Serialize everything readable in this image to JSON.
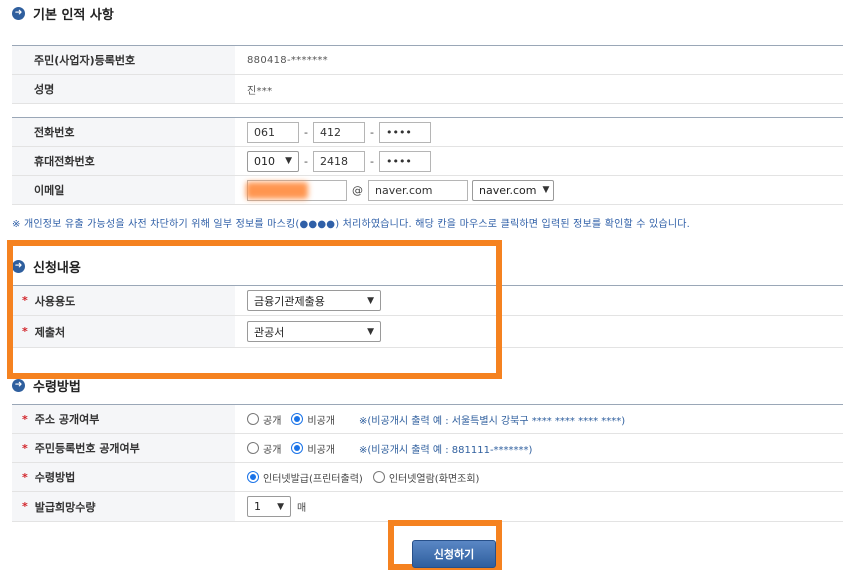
{
  "basic": {
    "title": "기본 인적 사항",
    "rrn_label": "주민(사업자)등록번호",
    "rrn_value": "880418-*******",
    "name_label": "성명",
    "name_value": "진***"
  },
  "contact": {
    "phone_label": "전화번호",
    "phone": [
      "061",
      "412",
      "••••"
    ],
    "mobile_label": "휴대전화번호",
    "mobile_prefix": "010",
    "mobile": [
      "2418",
      "••••"
    ],
    "email_label": "이메일",
    "email_at": "@",
    "email_domain": "naver.com",
    "email_domain_select": "naver.com",
    "dash": "-"
  },
  "notice": "※ 개인정보 유출 가능성을 사전 차단하기 위해 일부 정보를 마스킹(●●●●) 처리하였습니다. 해당 칸을 마우스로 클릭하면 입력된 정보를 확인할 수 있습니다.",
  "application": {
    "title": "신청내용",
    "purpose_label": "사용용도",
    "purpose_value": "금융기관제출용",
    "submit_to_label": "제출처",
    "submit_to_value": "관공서"
  },
  "receipt": {
    "title": "수령방법",
    "addr_label": "주소 공개여부",
    "addr_public": "공개",
    "addr_private": "비공개",
    "addr_note": "※(비공개시 출력 예 : 서울특별시 강북구 **** **** **** ****)",
    "rrn_label": "주민등록번호 공개여부",
    "rrn_public": "공개",
    "rrn_private": "비공개",
    "rrn_note": "※(비공개시 출력 예 : 881111-*******)",
    "method_label": "수령방법",
    "method_online_print": "인터넷발급(프린터출력)",
    "method_online_view": "인터넷열람(화면조회)",
    "qty_label": "발급희망수량",
    "qty_value": "1",
    "qty_unit": "매"
  },
  "submit_label": "신청하기",
  "required_mark": "*",
  "icon_glyph": "➜",
  "colors": {
    "highlight": "#f58220",
    "accent": "#2f5f9e",
    "required": "#d2242a"
  }
}
